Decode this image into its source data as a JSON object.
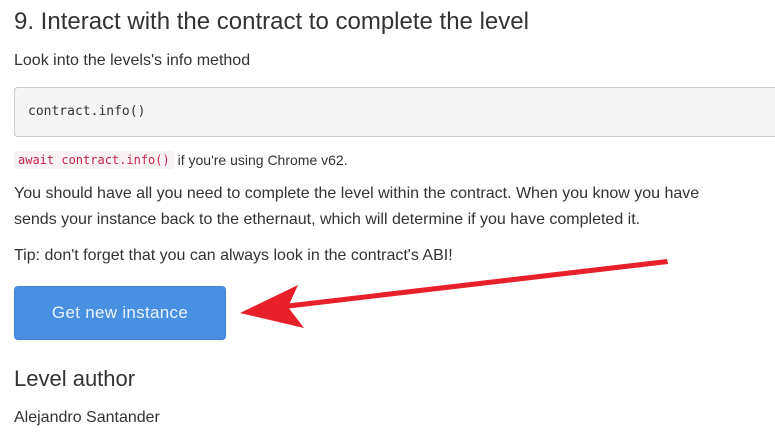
{
  "step": {
    "heading": "9. Interact with the contract to complete the level",
    "info_text": "Look into the levels's info method",
    "code": "contract.info()",
    "chrome_code": "await contract.info()",
    "chrome_note": " if you're using Chrome v62.",
    "desc_line1": "You should have all you need to complete the level within the contract. When you know you have",
    "desc_line2": "sends your instance back to the ethernaut, which will determine if you have completed it.",
    "tip": "Tip: don't forget that you can always look in the contract's ABI!"
  },
  "button": {
    "label": "Get new instance"
  },
  "author": {
    "heading": "Level author",
    "name": "Alejandro Santander"
  },
  "colors": {
    "button": "#4a90e2",
    "arrow": "#e8202a",
    "inline_code": "#c7254e"
  },
  "icons": {
    "annotation": "red-arrow-icon"
  }
}
